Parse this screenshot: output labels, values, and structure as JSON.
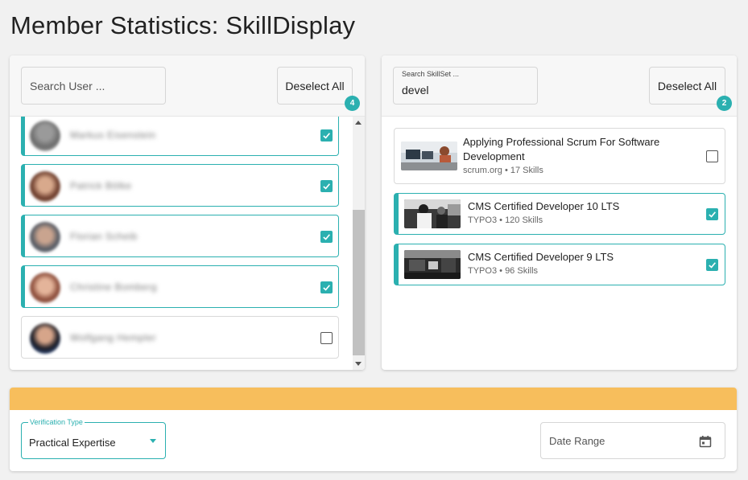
{
  "page": {
    "title": "Member Statistics: SkillDisplay"
  },
  "users_panel": {
    "search_placeholder": "Search User ...",
    "deselect_label": "Deselect All",
    "selected_count": "4",
    "users": [
      {
        "name": "Markus Eisenstein",
        "selected": true
      },
      {
        "name": "Patrick Bölke",
        "selected": true
      },
      {
        "name": "Florian Scheib",
        "selected": true
      },
      {
        "name": "Christine Bomberg",
        "selected": true
      },
      {
        "name": "Wolfgang Hempler",
        "selected": false
      }
    ]
  },
  "skills_panel": {
    "search_label": "Search SkillSet ...",
    "search_value": "devel",
    "deselect_label": "Deselect All",
    "selected_count": "2",
    "skillsets": [
      {
        "title": "Applying Professional Scrum For Software Development",
        "provider": "scrum.org",
        "skills": "17 Skills",
        "selected": false
      },
      {
        "title": "CMS Certified Developer 10 LTS",
        "provider": "TYPO3",
        "skills": "120 Skills",
        "selected": true
      },
      {
        "title": "CMS Certified Developer 9 LTS",
        "provider": "TYPO3",
        "skills": "96 Skills",
        "selected": true
      }
    ]
  },
  "filters": {
    "verification_label": "Verification Type",
    "verification_value": "Practical Expertise",
    "date_range_placeholder": "Date Range"
  },
  "colors": {
    "accent": "#2bb0b0",
    "filter_bar": "#f7be5c"
  }
}
